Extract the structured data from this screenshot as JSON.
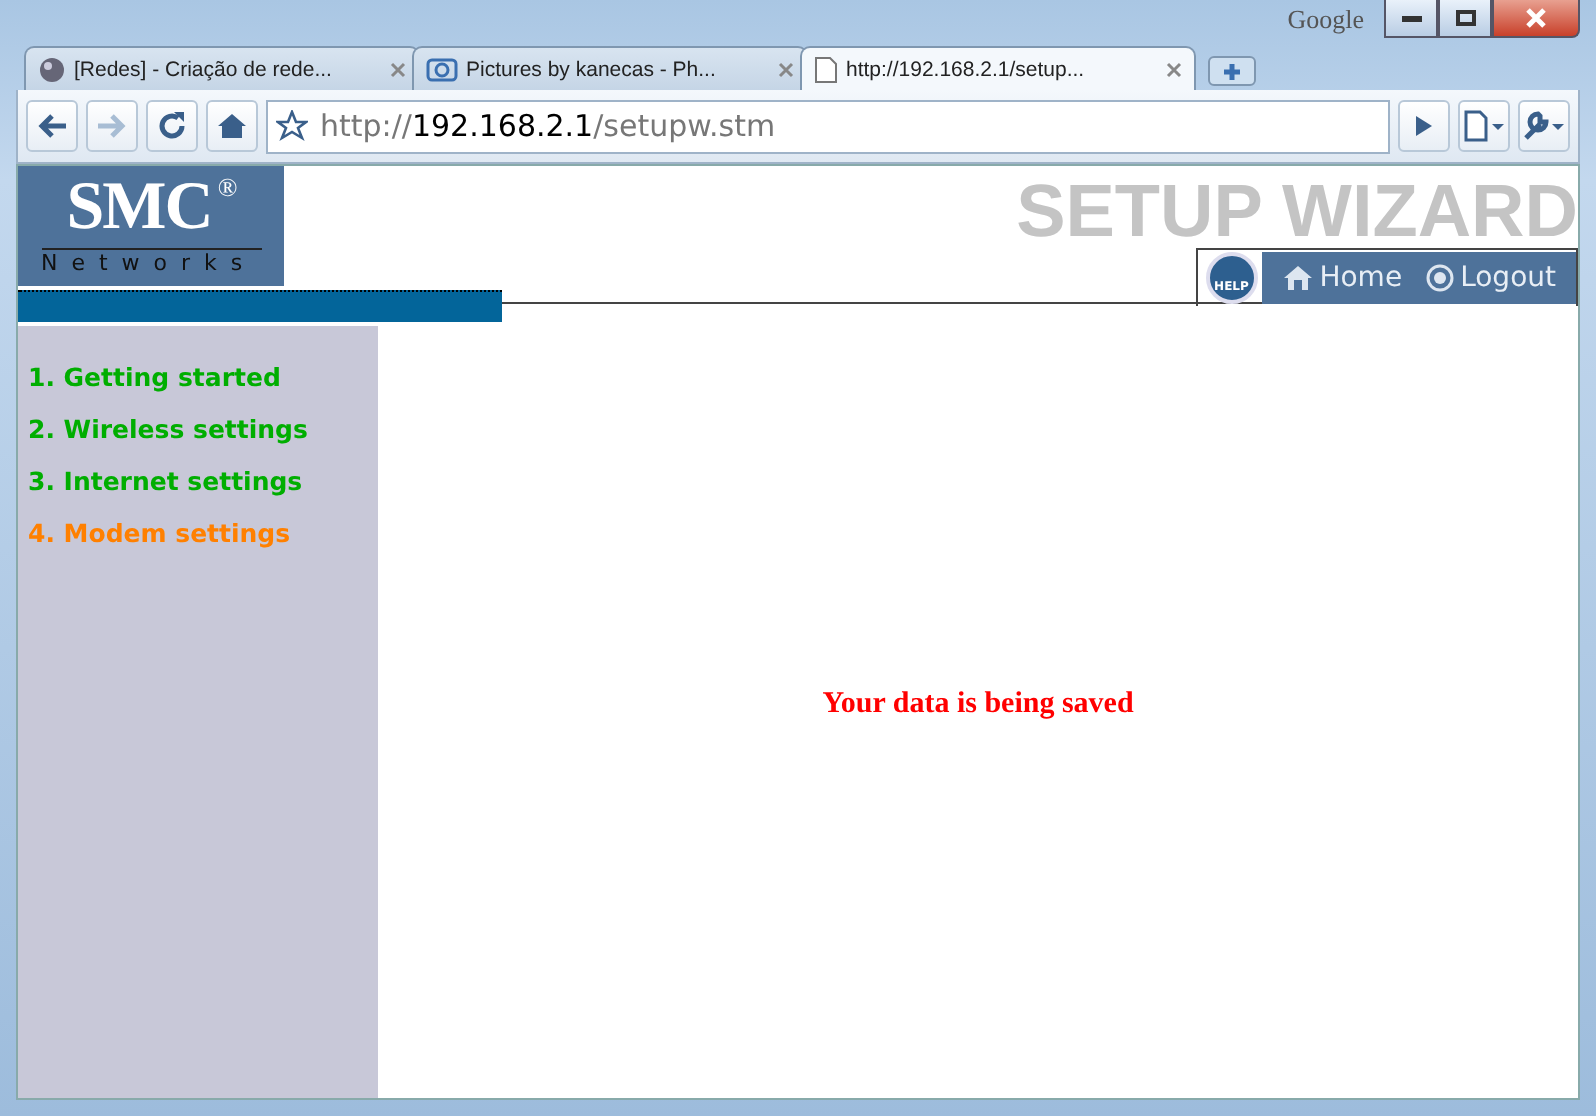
{
  "browser": {
    "brand": "Google",
    "tabs": [
      {
        "title": "[Redes] - Criação de rede...",
        "selected": false
      },
      {
        "title": "Pictures by kanecas - Ph...",
        "selected": false
      },
      {
        "title": "http://192.168.2.1/setup...",
        "selected": true
      }
    ],
    "address": {
      "scheme": "http://",
      "host": "192.168.2.1",
      "path": "/setupw.stm"
    }
  },
  "page": {
    "logo": {
      "name": "SMC",
      "mark": "®",
      "sub": "Networks"
    },
    "title": "SETUP WIZARD",
    "nav": {
      "help": "HELP",
      "links": [
        {
          "label": "Home"
        },
        {
          "label": "Logout"
        }
      ]
    },
    "steps": [
      {
        "label": "1. Getting started",
        "selected": false
      },
      {
        "label": "2. Wireless settings",
        "selected": false
      },
      {
        "label": "3. Internet settings",
        "selected": false
      },
      {
        "label": "4. Modem settings",
        "selected": true
      }
    ],
    "message": "Your data is being saved"
  }
}
